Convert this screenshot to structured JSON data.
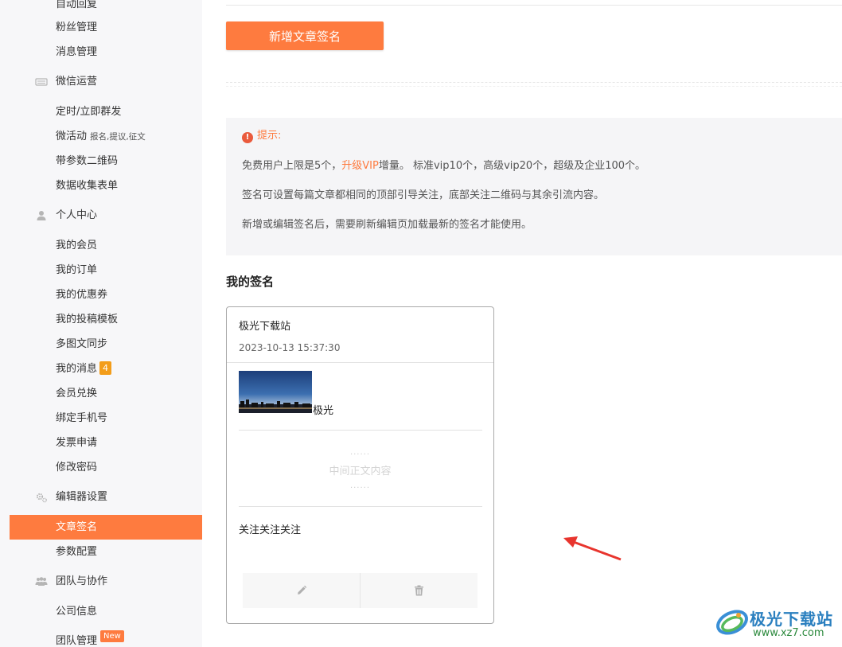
{
  "sidebar": {
    "auto_reply": "自动回复",
    "fans": "粉丝管理",
    "messages": "消息管理",
    "wechat_ops": "微信运营",
    "scheduled_send": "定时/立即群发",
    "micro_activity": "微活动",
    "micro_activity_aux": "报名,提议,征文",
    "param_qr": "带参数二维码",
    "data_form": "数据收集表单",
    "personal_center": "个人中心",
    "my_member": "我的会员",
    "my_orders": "我的订单",
    "my_coupons": "我的优惠券",
    "my_templates": "我的投稿模板",
    "multi_sync": "多图文同步",
    "my_messages": "我的消息",
    "my_messages_count": "4",
    "member_exchange": "会员兑换",
    "bind_phone": "绑定手机号",
    "invoice": "发票申请",
    "change_password": "修改密码",
    "editor_settings": "编辑器设置",
    "article_signature": "文章签名",
    "param_config": "参数配置",
    "team": "团队与协作",
    "company_info": "公司信息",
    "team_manage": "团队管理",
    "team_manage_badge": "New"
  },
  "main": {
    "new_button": "新增文章签名",
    "tip": {
      "title": "提示:",
      "line1_a": "免费用户上限是5个，",
      "line1_link": "升级VIP",
      "line1_b": "增量。 标准vip10个，高级vip20个，超级及企业100个。",
      "line2": "签名可设置每篇文章都相同的顶部引导关注，底部关注二维码与其余引流内容。",
      "line3": "新增或编辑签名后，需要刷新编辑页加载最新的签名才能使用。"
    },
    "section_title": "我的签名",
    "card": {
      "name": "极光下载站",
      "date": "2023-10-13 15:37:30",
      "image_caption": "极光",
      "dots": "......",
      "middle_text": "中间正文内容",
      "follow_text": "关注关注关注"
    }
  },
  "watermark": {
    "name": "极光下载站",
    "url": "www.xz7.com"
  },
  "colors": {
    "accent": "#fe7b3f",
    "sidebar_bg": "#f7f7f9",
    "tip_bg": "#f5f5f7"
  }
}
